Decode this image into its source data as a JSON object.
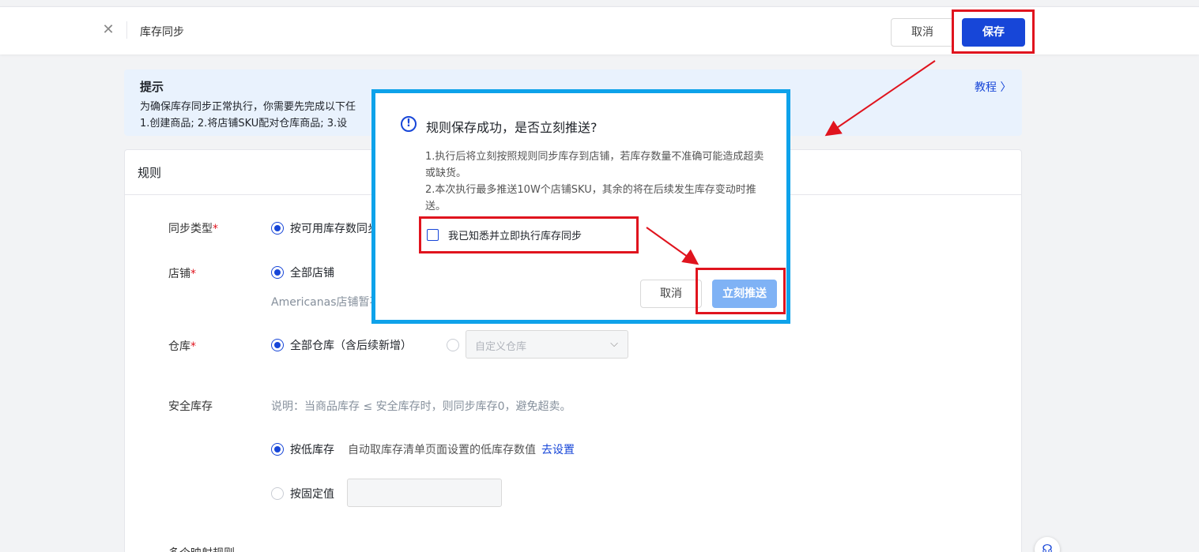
{
  "header": {
    "close_icon": "close-icon",
    "title": "库存同步",
    "cancel_label": "取消",
    "save_label": "保存"
  },
  "tip": {
    "title": "提示",
    "line1": "为确保库存同步正常执行，你需要先完成以下任",
    "line2": "1.创建商品;   2.将店铺SKU配对仓库商品;   3.设",
    "tutorial_link": "教程 〉"
  },
  "rules": {
    "card_title": "规则",
    "sync_type": {
      "label": "同步类型",
      "required": "*",
      "option": "按可用库存数同步"
    },
    "store": {
      "label": "店铺",
      "required": "*",
      "option": "全部店铺",
      "note": "Americanas店铺暂不"
    },
    "warehouse": {
      "label": "仓库",
      "required": "*",
      "option_all": "全部仓库（含后续新增）",
      "custom_placeholder": "自定义仓库"
    },
    "safety_stock": {
      "label": "安全库存",
      "description": "说明：当商品库存 ≤ 安全库存时，则同步库存0，避免超卖。",
      "option_low": "按低库存",
      "option_low_hint": "自动取库存清单页面设置的低库存数值",
      "go_set_link": "去设置",
      "option_fixed": "按固定值"
    },
    "mapping_label": "多个映射规则"
  },
  "modal": {
    "icon": "info-circle-icon",
    "title": "规则保存成功，是否立刻推送?",
    "desc_line1": "1.执行后将立刻按照规则同步库存到店铺，若库存数量不准确可能造成超卖或缺货。",
    "desc_line2": "2.本次执行最多推送10W个店铺SKU，其余的将在后续发生库存变动时推送。",
    "checkbox_label": "我已知悉并立即执行库存同步",
    "checkbox_checked": false,
    "cancel_label": "取消",
    "push_label": "立刻推送"
  },
  "annotation_colors": {
    "highlight_box": "#e0141e",
    "modal_frame": "#0ea2ea",
    "arrow": "#e0141e"
  }
}
